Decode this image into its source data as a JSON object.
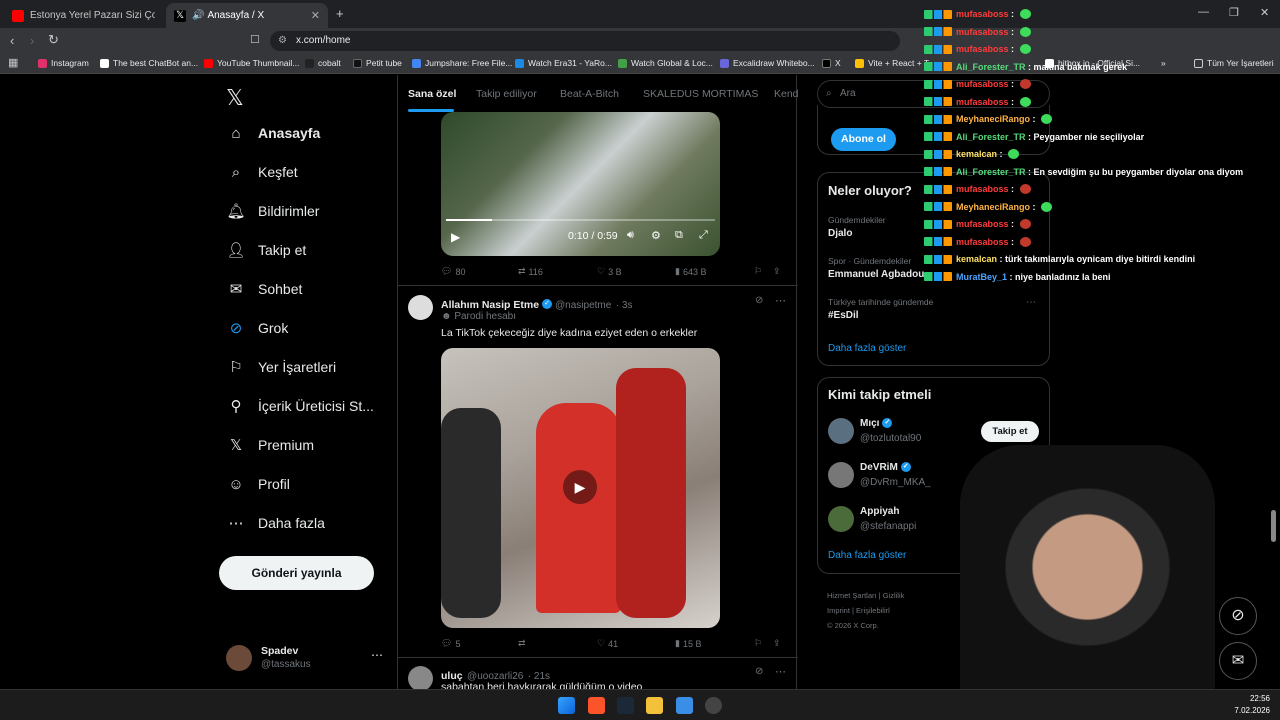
{
  "browser": {
    "tabs": [
      {
        "title": "Estonya Yerel Pazarı Sizi Çok Şaşırtacak",
        "active": false
      },
      {
        "title": "Anasayfa / X",
        "active": true
      }
    ],
    "url": "x.com/home",
    "bookmarks": [
      "Instagram",
      "The best ChatBot an...",
      "YouTube Thumbnail...",
      "cobalt",
      "Petit tube",
      "Jumpshare: Free File...",
      "Watch Era31 - YaRo...",
      "Watch Global & Loc...",
      "Excalidraw Whitebo...",
      "X",
      "Vite + React + T",
      "hitbox.io - Official Si..."
    ],
    "all_bookmarks": "Tüm Yer İşaretleri"
  },
  "sidebar": {
    "items": [
      {
        "label": "Anasayfa",
        "icon": "home-icon"
      },
      {
        "label": "Keşfet",
        "icon": "search-icon"
      },
      {
        "label": "Bildirimler",
        "icon": "bell-icon"
      },
      {
        "label": "Takip et",
        "icon": "follow-icon"
      },
      {
        "label": "Sohbet",
        "icon": "mail-icon"
      },
      {
        "label": "Grok",
        "icon": "grok-icon"
      },
      {
        "label": "Yer İşaretleri",
        "icon": "bookmark-icon"
      },
      {
        "label": "İçerik Üreticisi St...",
        "icon": "creator-icon"
      },
      {
        "label": "Premium",
        "icon": "x-icon"
      },
      {
        "label": "Profil",
        "icon": "person-icon"
      },
      {
        "label": "Daha fazla",
        "icon": "more-icon"
      }
    ],
    "post_button": "Gönderi yayınla",
    "account": {
      "name": "Spadev",
      "handle": "@tassakus"
    }
  },
  "timeline": {
    "tabs": [
      "Sana özel",
      "Takip ediliyor",
      "Beat-A-Bitch",
      "SKALEDUS MORTIMAS",
      "Kend"
    ],
    "video1": {
      "time": "0:10 / 0:59",
      "progress": 0.17
    },
    "tweet1_actions": {
      "replies": "80",
      "reposts": "116",
      "likes": "3 B",
      "views": "643 B"
    },
    "tweet2": {
      "name": "Allahım Nasip Etme",
      "handle": "@nasipetme",
      "time": "· 3s",
      "parody": "Parodi hesabı",
      "text": "La TikTok çekeceğiz diye kadına eziyet eden o erkekler",
      "actions": {
        "replies": "5",
        "reposts": "",
        "likes": "41",
        "views": "15 B"
      }
    },
    "tweet3": {
      "name": "uluç",
      "handle": "@uoozarli26",
      "time": "· 21s",
      "text": "sabahtan beri haykırarak güldüğüm o video"
    }
  },
  "right": {
    "search_placeholder": "Ara",
    "subscribe": "Abone ol",
    "trends_title": "Neler oluyor?",
    "trends": [
      {
        "category": "Gündemdekiler",
        "name": "Djalo"
      },
      {
        "category": "Spor · Gündemdekiler",
        "name": "Emmanuel Agbadou"
      },
      {
        "category": "Türkiye tarihinde gündemde",
        "name": "#EsDil"
      }
    ],
    "trends_more": "Daha fazla göster",
    "follow_title": "Kimi takip etmeli",
    "follows": [
      {
        "name": "Mıçı",
        "handle": "@tozlutotal90",
        "button": "Takip et"
      },
      {
        "name": "DeVRiM",
        "handle": "@DvRm_MKA_",
        "button": ""
      },
      {
        "name": "Appiyah",
        "handle": "@stefanappi",
        "button": ""
      }
    ],
    "follow_more": "Daha fazla göster",
    "footer": [
      "Hizmet Şartları",
      "Gizlilik",
      "Imprint",
      "Erişilebilirl",
      "© 2026 X Corp."
    ]
  },
  "chat": [
    {
      "user": "mufasaboss",
      "msg": "",
      "color": "#ff3b3b"
    },
    {
      "user": "mufasaboss",
      "msg": "",
      "color": "#ff3b3b"
    },
    {
      "user": "mufasaboss",
      "msg": "",
      "color": "#ff3b3b"
    },
    {
      "user": "Ali_Forester_TR",
      "msg": "makina bakmak gerek",
      "color": "#56d97b"
    },
    {
      "user": "mufasaboss",
      "msg": "",
      "color": "#ff3b3b"
    },
    {
      "user": "mufasaboss",
      "msg": "",
      "color": "#ff3b3b"
    },
    {
      "user": "MeyhaneciRango",
      "msg": "",
      "color": "#ffb347"
    },
    {
      "user": "Ali_Forester_TR",
      "msg": "Peygamber nie seçiliyolar",
      "color": "#56d97b"
    },
    {
      "user": "kemalcan",
      "msg": "",
      "color": "#ffe066"
    },
    {
      "user": "Ali_Forester_TR",
      "msg": "En sevdiğim şu bu peygamber diyolar ona diyom",
      "color": "#56d97b"
    },
    {
      "user": "mufasaboss",
      "msg": "",
      "color": "#ff3b3b"
    },
    {
      "user": "MeyhaneciRango",
      "msg": "",
      "color": "#ffb347"
    },
    {
      "user": "mufasaboss",
      "msg": "",
      "color": "#ff3b3b"
    },
    {
      "user": "mufasaboss",
      "msg": "",
      "color": "#ff3b3b"
    },
    {
      "user": "kemalcan",
      "msg": "türk takımlarıyla oynicam diye bitirdi kendini",
      "color": "#ffe066"
    },
    {
      "user": "MuratBey_1",
      "msg": "niye banladınız la beni",
      "color": "#4ea3ff"
    }
  ],
  "taskbar": {
    "time": "22:56",
    "date": "7.02.2026"
  }
}
